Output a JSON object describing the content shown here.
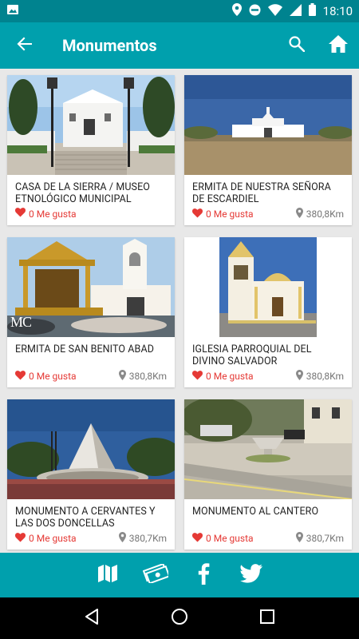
{
  "status_bar": {
    "time": "18:10"
  },
  "app_bar": {
    "title": "Monumentos"
  },
  "cards": [
    {
      "name": "CASA DE LA SIERRA / MUSEO ETNOLÓGICO MUNICIPAL",
      "likes": "0 Me gusta",
      "distance": ""
    },
    {
      "name": "ERMITA DE NUESTRA SEÑORA DE ESCARDIEL",
      "likes": "0 Me gusta",
      "distance": "380,8Km"
    },
    {
      "name": "ERMITA DE SAN BENITO ABAD",
      "likes": "0 Me gusta",
      "distance": "380,8Km",
      "photo_mark": "MC"
    },
    {
      "name": "IGLESIA PARROQUIAL DEL DIVINO SALVADOR",
      "likes": "0 Me gusta",
      "distance": "380,8Km"
    },
    {
      "name": "MONUMENTO A CERVANTES Y LAS DOS DONCELLAS",
      "likes": "0 Me gusta",
      "distance": "380,7Km"
    },
    {
      "name": "MONUMENTO AL CANTERO",
      "likes": "0 Me gusta",
      "distance": "380,7Km"
    }
  ],
  "bottom_bar": {
    "items": [
      {
        "icon": "map-icon"
      },
      {
        "icon": "money-icon"
      },
      {
        "icon": "facebook-icon"
      },
      {
        "icon": "twitter-icon"
      }
    ]
  },
  "colors": {
    "primary": "#00a0ad",
    "status": "#00838f",
    "like": "#e53935",
    "distance": "#757575"
  }
}
